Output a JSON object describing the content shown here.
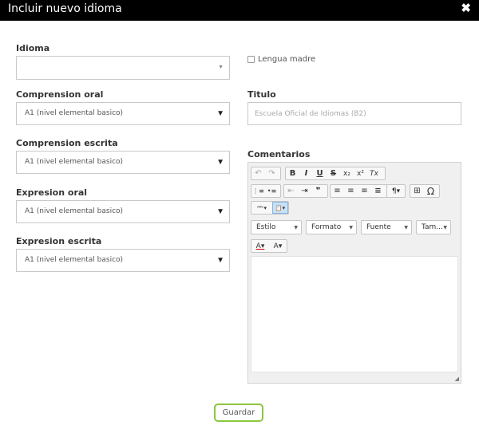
{
  "dialog": {
    "title": "Incluir nuevo idioma",
    "close_glyph": "✖"
  },
  "form": {
    "idioma": {
      "label": "Idioma",
      "value": ""
    },
    "lengua_madre": {
      "label": "Lengua madre",
      "checked": false
    },
    "comprension_oral": {
      "label": "Comprension oral",
      "value": "A1 (nivel elemental basico)"
    },
    "titulo": {
      "label": "Titulo",
      "placeholder": "Escuela Oficial de Idiomas (B2)"
    },
    "comprension_escrita": {
      "label": "Comprension escrita",
      "value": "A1 (nivel elemental basico)"
    },
    "comentarios": {
      "label": "Comentarios"
    },
    "expresion_oral": {
      "label": "Expresion oral",
      "value": "A1 (nivel elemental basico)"
    },
    "expresion_escrita": {
      "label": "Expresion escrita",
      "value": "A1 (nivel elemental basico)"
    }
  },
  "editor": {
    "toolbar": {
      "undo": "↶",
      "redo": "↷",
      "bold": "B",
      "italic": "I",
      "underline": "U",
      "strike": "S",
      "subscript": "x₂",
      "superscript": "x²",
      "remove_format": "Tx",
      "numbered_list": "⋮≡",
      "bullet_list": "•≡",
      "outdent": "⇤",
      "indent": "⇥",
      "blockquote": "❞",
      "align_left": "≡",
      "align_center": "≡",
      "align_right": "≡",
      "justify": "≡",
      "bidi": "¶▾",
      "table": "⊞",
      "special_char": "Ω",
      "spellcheck": "ᴬᴮᶜ▾",
      "paste_text": "📋▾",
      "style": "Estilo",
      "format": "Formato",
      "font": "Fuente",
      "size": "Tam...",
      "text_color": "A▾",
      "bg_color": "A▾"
    }
  },
  "actions": {
    "save": "Guardar"
  }
}
